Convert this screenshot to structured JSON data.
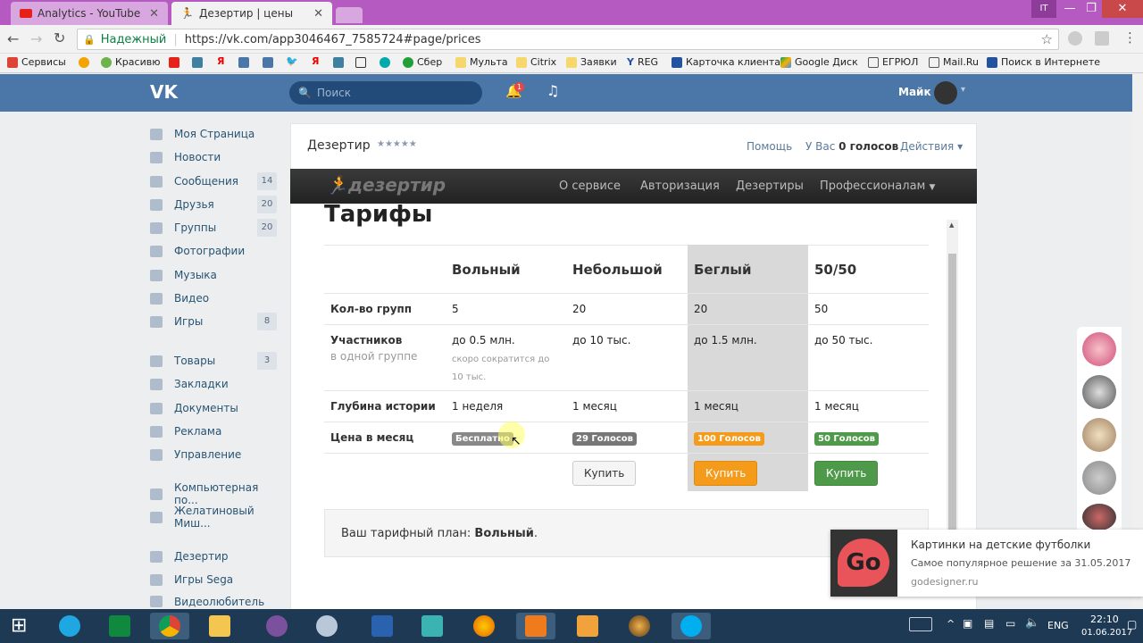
{
  "browser": {
    "tabs": [
      {
        "title": "Analytics - YouTube"
      },
      {
        "title": "Дезертир | цены"
      }
    ],
    "profile_label": "IT",
    "secure_label": "Надежный",
    "url": "https://vk.com/app3046467_7585724#page/prices",
    "bookmarks": [
      "Сервисы",
      "Красивю",
      "Я",
      "Я",
      "Сбер",
      "Мульта",
      "Citrix",
      "Заявки",
      "REG",
      "Карточка клиента",
      "Google Диск",
      "ЕГРЮЛ",
      "Mail.Ru",
      "Поиск в Интернете"
    ]
  },
  "vk": {
    "search_placeholder": "Поиск",
    "notif_count": "1",
    "user_name": "Майк",
    "menu": [
      {
        "label": "Моя Страница",
        "count": ""
      },
      {
        "label": "Новости",
        "count": ""
      },
      {
        "label": "Сообщения",
        "count": "14"
      },
      {
        "label": "Друзья",
        "count": "20"
      },
      {
        "label": "Группы",
        "count": "20"
      },
      {
        "label": "Фотографии",
        "count": ""
      },
      {
        "label": "Музыка",
        "count": ""
      },
      {
        "label": "Видео",
        "count": ""
      },
      {
        "label": "Игры",
        "count": "8"
      },
      {
        "label": "Товары",
        "count": "3"
      },
      {
        "label": "Закладки",
        "count": ""
      },
      {
        "label": "Документы",
        "count": ""
      },
      {
        "label": "Реклама",
        "count": ""
      },
      {
        "label": "Управление",
        "count": ""
      },
      {
        "label": "Компьютерная по...",
        "count": ""
      },
      {
        "label": "Желатиновый Миш...",
        "count": ""
      },
      {
        "label": "Дезертир",
        "count": ""
      },
      {
        "label": "Игры Sega",
        "count": ""
      },
      {
        "label": "Видеолюбитель",
        "count": ""
      }
    ]
  },
  "app": {
    "name": "Дезертир",
    "rating": "★★★★★",
    "help": "Помощь",
    "votes_prefix": "У Вас",
    "votes_value": "0 голосов",
    "actions": "Действия",
    "logo_text": "дезертир",
    "nav": [
      "О сервисе",
      "Авторизация",
      "Дезертиры",
      "Профессионалам"
    ],
    "page_title": "Тарифы",
    "plans": [
      "Вольный",
      "Небольшой",
      "Беглый",
      "50/50"
    ],
    "rows": {
      "groups_label": "Кол-во групп",
      "groups": [
        "5",
        "20",
        "20",
        "50"
      ],
      "members_label": "Участников",
      "members_sub": "в одной группе",
      "members": [
        "до 0.5 млн.",
        "до 10 тыс.",
        "до 1.5 млн.",
        "до 50 тыс."
      ],
      "members_note": "скоро сократится до 10 тыс.",
      "history_label": "Глубина истории",
      "history": [
        "1 неделя",
        "1 месяц",
        "1 месяц",
        "1 месяц"
      ],
      "price_label": "Цена в месяц",
      "prices": [
        "Бесплатно",
        "29 Голосов",
        "100 Голосов",
        "50 Голосов"
      ]
    },
    "buy": "Купить",
    "current_plan_prefix": "Ваш тарифный план:",
    "current_plan": "Вольный",
    "colors": {
      "free": "#888888",
      "gray": "#777777",
      "orange": "#f59b1c",
      "green": "#4e9a4a"
    }
  },
  "ad": {
    "logo": "Go",
    "title": "Картинки на детские футболки",
    "subtitle": "Самое популярное решение за 31.05.2017",
    "domain": "godesigner.ru"
  },
  "taskbar": {
    "lang": "ENG",
    "time": "22:10",
    "date": "01.06.2017"
  }
}
